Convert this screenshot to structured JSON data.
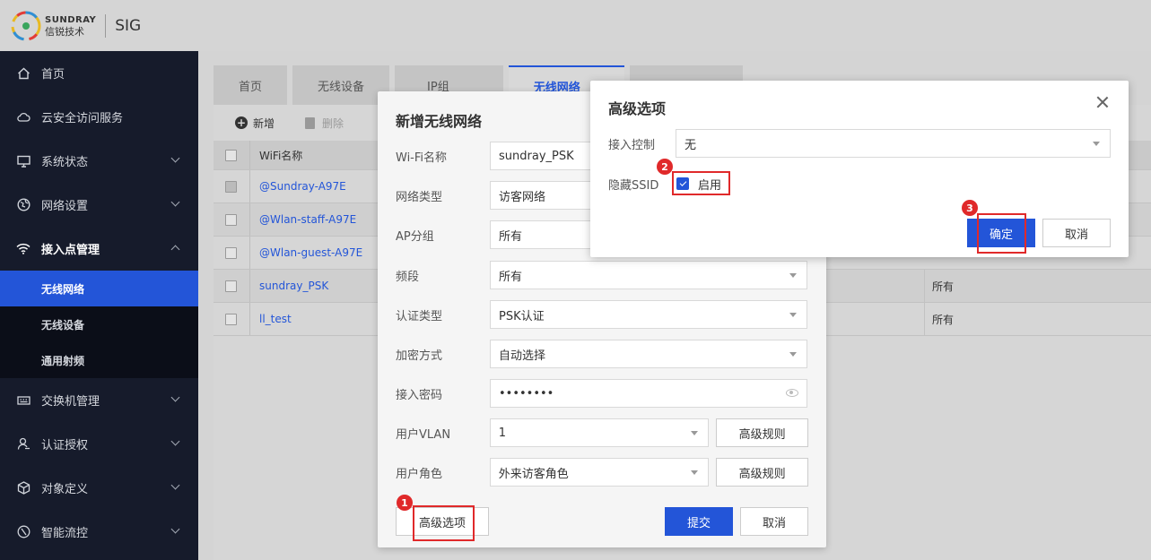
{
  "header": {
    "logo_en": "SUNDRAY",
    "logo_cn": "信锐技术",
    "product": "SIG"
  },
  "sidebar": {
    "items": [
      {
        "label": "首页",
        "icon": "home-icon"
      },
      {
        "label": "云安全访问服务",
        "icon": "cloud-security-icon"
      },
      {
        "label": "系统状态",
        "icon": "monitor-icon"
      },
      {
        "label": "网络设置",
        "icon": "globe-icon"
      },
      {
        "label": "接入点管理",
        "icon": "wifi-icon"
      },
      {
        "label": "交换机管理",
        "icon": "switch-icon"
      },
      {
        "label": "认证授权",
        "icon": "user-auth-icon"
      },
      {
        "label": "对象定义",
        "icon": "cube-icon"
      },
      {
        "label": "智能流控",
        "icon": "flow-control-icon"
      }
    ],
    "sub_items": [
      "无线网络",
      "无线设备",
      "通用射频"
    ]
  },
  "tabs": [
    "首页",
    "无线设备",
    "IP组",
    "无线网络"
  ],
  "toolbar": {
    "add": "新增",
    "delete": "删除"
  },
  "table": {
    "header": "WiFi名称",
    "rows": [
      "@Sundray-A97E",
      "@Wlan-staff-A97E",
      "@Wlan-guest-A97E",
      "sundray_PSK",
      "ll_test"
    ],
    "right_values": [
      "所有",
      "所有"
    ]
  },
  "new_dialog": {
    "title": "新增无线网络",
    "fields": [
      {
        "label": "Wi-Fi名称",
        "value": "sundray_PSK"
      },
      {
        "label": "网络类型",
        "value": "访客网络"
      },
      {
        "label": "AP分组",
        "value": "所有"
      },
      {
        "label": "频段",
        "value": "所有"
      },
      {
        "label": "认证类型",
        "value": "PSK认证"
      },
      {
        "label": "加密方式",
        "value": "自动选择"
      },
      {
        "label": "接入密码",
        "value": "••••••••"
      },
      {
        "label": "用户VLAN",
        "value": "1"
      },
      {
        "label": "用户角色",
        "value": "外来访客角色"
      }
    ],
    "rule_button": "高级规则",
    "advanced_button": "高级选项",
    "submit": "提交",
    "cancel": "取消"
  },
  "adv_dialog": {
    "title": "高级选项",
    "access_control_label": "接入控制",
    "access_control_value": "无",
    "hide_ssid_label": "隐藏SSID",
    "hide_ssid_option": "启用",
    "hide_ssid_checked": true,
    "ok": "确定",
    "cancel": "取消"
  },
  "badges": [
    "1",
    "2",
    "3"
  ],
  "colors": {
    "accent": "#2355d8",
    "sidebar": "#161b2b",
    "highlight": "#e0292a"
  }
}
